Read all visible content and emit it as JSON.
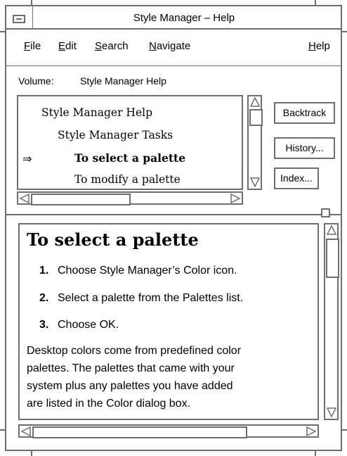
{
  "window": {
    "title": "Style Manager – Help"
  },
  "menubar": {
    "file": {
      "mnemonic": "F",
      "rest": "ile"
    },
    "edit": {
      "mnemonic": "E",
      "rest": "dit"
    },
    "search": {
      "mnemonic": "S",
      "rest": "earch"
    },
    "navigate": {
      "mnemonic": "N",
      "rest": "avigate"
    },
    "help": {
      "mnemonic": "H",
      "rest": "elp"
    }
  },
  "volume": {
    "label": "Volume:",
    "value": "Style Manager Help"
  },
  "topics": [
    {
      "label": "Style Manager Help"
    },
    {
      "label": "Style Manager Tasks"
    },
    {
      "label": "To select a palette",
      "current": true
    },
    {
      "label": "To modify a palette"
    }
  ],
  "current_marker": "⇒",
  "buttons": {
    "backtrack": "Backtrack",
    "history": "History...",
    "index": "Index..."
  },
  "content": {
    "title": "To select a palette",
    "steps": [
      {
        "num": "1.",
        "text": "Choose Style Manager’s Color icon."
      },
      {
        "num": "2.",
        "text": "Select a palette from the Palettes list."
      },
      {
        "num": "3.",
        "text": "Choose OK."
      }
    ],
    "paragraph_lines": [
      "Desktop colors come from predefined color",
      "palettes. The palettes that came with your",
      "system plus any palettes you have added",
      "are listed in the Color dialog box."
    ]
  },
  "colors": {
    "frame": "#6e6e6e",
    "background": "#ffffff",
    "text": "#000000"
  },
  "icons": {
    "window_menu": "window-menu-icon",
    "scroll_up": "scroll-up-arrow-icon",
    "scroll_down": "scroll-down-arrow-icon",
    "scroll_left": "scroll-left-arrow-icon",
    "scroll_right": "scroll-right-arrow-icon",
    "sash": "pane-sash-icon"
  }
}
